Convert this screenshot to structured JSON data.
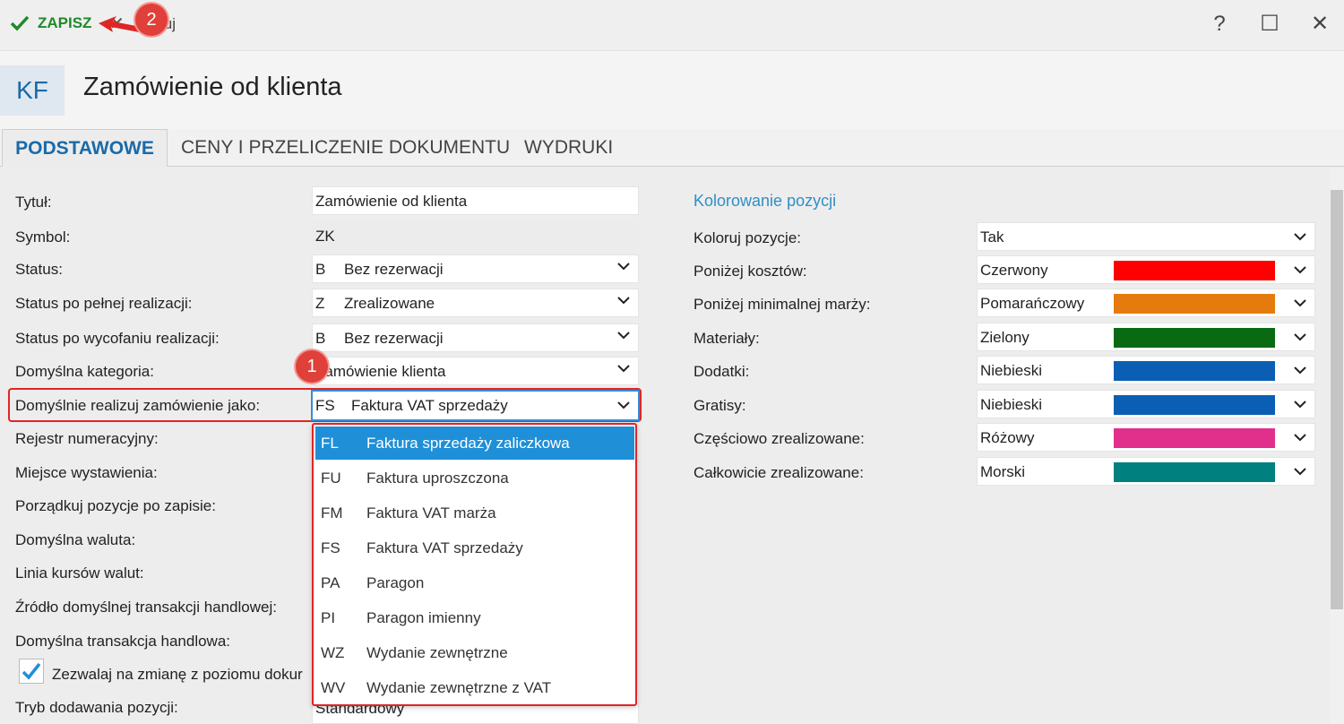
{
  "toolbar": {
    "save_label": "ZAPISZ",
    "cancel_label": "Anuluj",
    "help": "?",
    "maximize": "☐",
    "close": "✕"
  },
  "header": {
    "badge": "KF",
    "title": "Zamówienie od klienta"
  },
  "tabs": [
    {
      "label": "PODSTAWOWE",
      "active": true
    },
    {
      "label": "CENY I PRZELICZENIE DOKUMENTU",
      "active": false
    },
    {
      "label": "WYDRUKI",
      "active": false
    }
  ],
  "form": {
    "tytul": {
      "label": "Tytuł:",
      "value": "Zamówienie od klienta"
    },
    "symbol": {
      "label": "Symbol:",
      "value": "ZK"
    },
    "status": {
      "label": "Status:",
      "code": "B",
      "value": "Bez rezerwacji"
    },
    "status_pelna": {
      "label": "Status po pełnej realizacji:",
      "code": "Z",
      "value": "Zrealizowane"
    },
    "status_wycofanie": {
      "label": "Status po wycofaniu realizacji:",
      "code": "B",
      "value": "Bez rezerwacji"
    },
    "kategoria": {
      "label": "Domyślna kategoria:",
      "value": "Zamówienie klienta"
    },
    "realizuj": {
      "label": "Domyślnie realizuj zamówienie jako:",
      "code": "FS",
      "value": "Faktura VAT sprzedaży"
    },
    "rejestr": {
      "label": "Rejestr numeracyjny:"
    },
    "miejsce": {
      "label": "Miejsce wystawienia:"
    },
    "porzadkuj": {
      "label": "Porządkuj pozycje po zapisie:"
    },
    "waluta": {
      "label": "Domyślna waluta:"
    },
    "linia": {
      "label": "Linia kursów walut:"
    },
    "zrodlo": {
      "label": "Źródło domyślnej transakcji handlowej:"
    },
    "transakcja": {
      "label": "Domyślna transakcja handlowa:"
    },
    "zezwalaj": {
      "label": "Zezwalaj na zmianę z poziomu dokur",
      "checked": true
    },
    "tryb": {
      "label": "Tryb dodawania pozycji:",
      "value": "Standardowy"
    }
  },
  "dropdown": {
    "items": [
      {
        "code": "FL",
        "name": "Faktura sprzedaży zaliczkowa",
        "selected": true
      },
      {
        "code": "FU",
        "name": "Faktura uproszczona"
      },
      {
        "code": "FM",
        "name": "Faktura VAT marża"
      },
      {
        "code": "FS",
        "name": "Faktura VAT sprzedaży"
      },
      {
        "code": "PA",
        "name": "Paragon"
      },
      {
        "code": "PI",
        "name": "Paragon imienny"
      },
      {
        "code": "WZ",
        "name": "Wydanie zewnętrzne"
      },
      {
        "code": "WV",
        "name": "Wydanie zewnętrzne z VAT"
      }
    ]
  },
  "coloring": {
    "title": "Kolorowanie pozycji",
    "koloruj": {
      "label": "Koloruj pozycje:",
      "value": "Tak"
    },
    "rows": [
      {
        "label": "Poniżej kosztów:",
        "value": "Czerwony",
        "color": "#ff0000"
      },
      {
        "label": "Poniżej minimalnej marży:",
        "value": "Pomarańczowy",
        "color": "#e57b0c"
      },
      {
        "label": "Materiały:",
        "value": "Zielony",
        "color": "#0a6a12"
      },
      {
        "label": "Dodatki:",
        "value": "Niebieski",
        "color": "#0a5fb4"
      },
      {
        "label": "Gratisy:",
        "value": "Niebieski",
        "color": "#0a5fb4"
      },
      {
        "label": "Częściowo zrealizowane:",
        "value": "Różowy",
        "color": "#e0308c"
      },
      {
        "label": "Całkowicie zrealizowane:",
        "value": "Morski",
        "color": "#00807e"
      }
    ]
  },
  "annotations": {
    "badge1": "1",
    "badge2": "2"
  },
  "colors": {
    "accent": "#1a6aa8",
    "save_green": "#1f8a2a",
    "highlight_red": "#e02525",
    "selected_blue": "#1f8fd8"
  }
}
